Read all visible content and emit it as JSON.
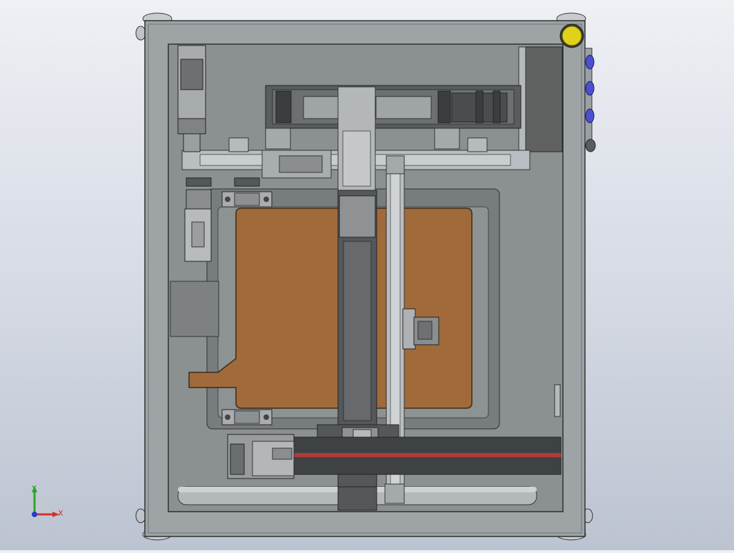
{
  "view": {
    "background_top": "#eef0f4",
    "background_bottom": "#bcc3d1"
  },
  "triad": {
    "x_label": "X",
    "y_label": "Y",
    "x_color": "#d23228",
    "y_color": "#2aa52a",
    "z_color": "#2a3ac8"
  },
  "model": {
    "frame_color": "#9ea3a5",
    "panel_color": "#8a9190",
    "bed_color": "#a06a3a",
    "rail_color": "#b9bec2",
    "dark_part_color": "#4a4d50",
    "indicator_light_color": "#e0d21a",
    "connector_color": "#4b4fd0"
  }
}
